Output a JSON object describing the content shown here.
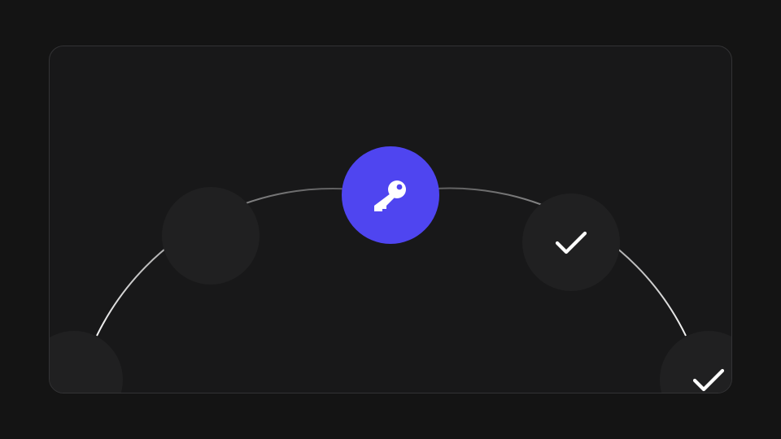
{
  "colors": {
    "background": "#141414",
    "card": "#181819",
    "card_border": "#333335",
    "node": "#202021",
    "accent": "#4f45f0",
    "icon": "#ffffff"
  },
  "steps": [
    {
      "state": "pending",
      "icon": "none"
    },
    {
      "state": "pending",
      "icon": "none"
    },
    {
      "state": "active",
      "icon": "key-icon"
    },
    {
      "state": "completed",
      "icon": "check-icon"
    },
    {
      "state": "completed",
      "icon": "check-icon"
    }
  ]
}
